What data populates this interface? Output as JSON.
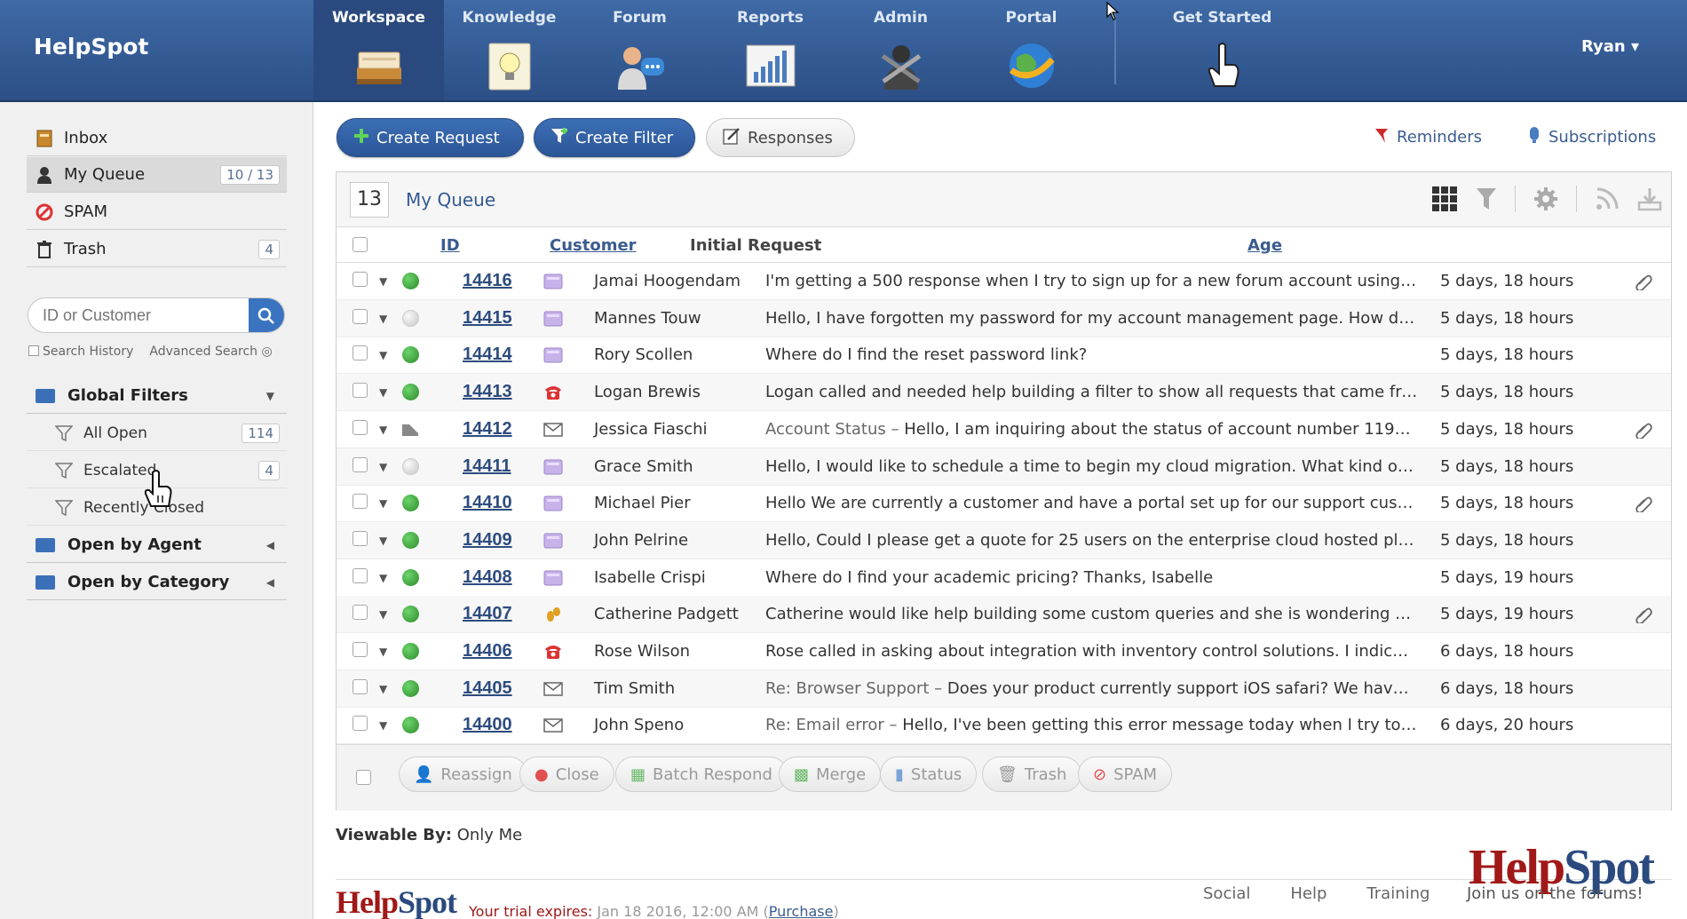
{
  "app": {
    "name": "HelpSpot",
    "user": "Ryan ▾"
  },
  "nav": {
    "tabs": [
      {
        "label": "Workspace",
        "icon": "inbox-tray-icon"
      },
      {
        "label": "Knowledge",
        "icon": "lightbulb-icon"
      },
      {
        "label": "Forum",
        "icon": "forum-user-icon"
      },
      {
        "label": "Reports",
        "icon": "bar-chart-icon"
      },
      {
        "label": "Admin",
        "icon": "admin-tools-icon"
      },
      {
        "label": "Portal",
        "icon": "globe-icon"
      },
      {
        "label": "Get Started",
        "icon": "pointing-hand-icon"
      }
    ]
  },
  "sidebar": {
    "items": [
      {
        "label": "Inbox",
        "count": ""
      },
      {
        "label": "My Queue",
        "count": "10 / 13"
      },
      {
        "label": "SPAM",
        "count": ""
      },
      {
        "label": "Trash",
        "count": "4"
      }
    ],
    "search": {
      "placeholder": "ID or Customer",
      "history_label": "Search History",
      "advanced_label": "Advanced Search"
    },
    "global_filters": {
      "label": "Global Filters",
      "items": [
        {
          "label": "All Open",
          "count": "114"
        },
        {
          "label": "Escalated",
          "count": "4"
        },
        {
          "label": "Recently Closed",
          "count": ""
        }
      ]
    },
    "open_by_agent": "Open by Agent",
    "open_by_category": "Open by Category"
  },
  "toolbar": {
    "create_request": "Create Request",
    "create_filter": "Create Filter",
    "responses": "Responses",
    "reminders": "Reminders",
    "subscriptions": "Subscriptions"
  },
  "queue": {
    "count": "13",
    "title": "My Queue",
    "columns": {
      "id": "ID",
      "customer": "Customer",
      "initial_request": "Initial Request",
      "age": "Age"
    },
    "rows": [
      {
        "status": "green",
        "id": "14416",
        "source": "portal",
        "customer": "Jamai Hoogendam",
        "subject": "",
        "request": "I'm getting a 500 response when I try to sign up for a new forum account using ...",
        "age": "5 days, 18 hours",
        "attachment": true
      },
      {
        "status": "grey",
        "id": "14415",
        "source": "portal",
        "customer": "Mannes Touw",
        "subject": "",
        "request": "Hello, I have forgotten my password for my account management page. How do I...",
        "age": "5 days, 18 hours",
        "attachment": false
      },
      {
        "status": "green",
        "id": "14414",
        "source": "portal",
        "customer": "Rory Scollen",
        "subject": "",
        "request": "Where do I find the reset password link?",
        "age": "5 days, 18 hours",
        "attachment": false
      },
      {
        "status": "green",
        "id": "14413",
        "source": "phone",
        "customer": "Logan Brewis",
        "subject": "",
        "request": "Logan called and needed help building a filter to show all requests that came fro...",
        "age": "5 days, 18 hours",
        "attachment": false
      },
      {
        "status": "closed",
        "id": "14412",
        "source": "email",
        "customer": "Jessica Fiaschi",
        "subject": "Account Status – ",
        "request": "Hello, I am inquiring about the status of account number 1192...",
        "age": "5 days, 18 hours",
        "attachment": true
      },
      {
        "status": "grey",
        "id": "14411",
        "source": "portal",
        "customer": "Grace Smith",
        "subject": "",
        "request": "Hello, I would like to schedule a time to begin my cloud migration. What kind of i...",
        "age": "5 days, 18 hours",
        "attachment": false
      },
      {
        "status": "green",
        "id": "14410",
        "source": "portal",
        "customer": "Michael Pier",
        "subject": "",
        "request": "Hello We are currently a customer and have a portal set up for our support custo...",
        "age": "5 days, 18 hours",
        "attachment": true
      },
      {
        "status": "green",
        "id": "14409",
        "source": "portal",
        "customer": "John Pelrine",
        "subject": "",
        "request": "Hello, Could I please get a quote for 25 users on the enterprise cloud hosted pla...",
        "age": "5 days, 18 hours",
        "attachment": false
      },
      {
        "status": "green",
        "id": "14408",
        "source": "portal",
        "customer": "Isabelle Crispi",
        "subject": "",
        "request": "Where do I find your academic pricing? Thanks, Isabelle",
        "age": "5 days, 19 hours",
        "attachment": false
      },
      {
        "status": "green",
        "id": "14407",
        "source": "walkin",
        "customer": "Catherine Padgett",
        "subject": "",
        "request": "Catherine would like help building some custom queries and she is wondering w...",
        "age": "5 days, 19 hours",
        "attachment": true
      },
      {
        "status": "green",
        "id": "14406",
        "source": "phone",
        "customer": "Rose Wilson",
        "subject": "",
        "request": "Rose called in asking about integration with inventory control solutions. I indicat...",
        "age": "6 days, 18 hours",
        "attachment": false
      },
      {
        "status": "green",
        "id": "14405",
        "source": "email",
        "customer": "Tim Smith",
        "subject": "Re: Browser Support – ",
        "request": "Does your product currently support iOS safari? We have a...",
        "age": "6 days, 18 hours",
        "attachment": false
      },
      {
        "status": "green",
        "id": "14400",
        "source": "email",
        "customer": "John Speno",
        "subject": "Re: Email error – ",
        "request": "Hello, I've been getting this error message today when I try to s...",
        "age": "6 days, 20 hours",
        "attachment": false
      }
    ],
    "batch": {
      "reassign": "Reassign",
      "close": "Close",
      "batch_respond": "Batch Respond",
      "merge": "Merge",
      "status": "Status",
      "trash": "Trash",
      "spam": "SPAM"
    },
    "viewable_label": "Viewable By:",
    "viewable_value": "Only Me"
  },
  "footer": {
    "logo_help": "Help",
    "logo_spot": "Spot",
    "trial_label": "Your trial expires:",
    "trial_date": "Jan 18 2016, 12:00 AM",
    "purchase": "Purchase",
    "links": [
      "Social",
      "Help",
      "Training"
    ],
    "forum_note": "Join us on the forums!"
  },
  "colors": {
    "brand_blue": "#2c4f86",
    "accent": "#3a73c0",
    "logo_red": "#a01818"
  }
}
